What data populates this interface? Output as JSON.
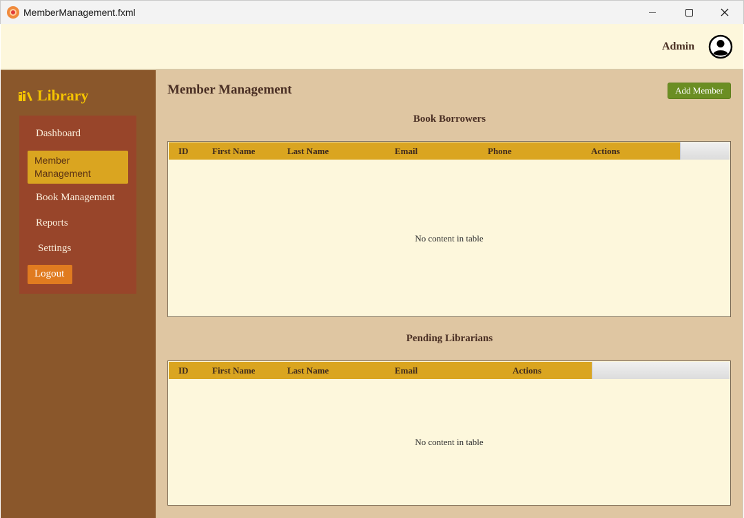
{
  "window": {
    "title": "MemberManagement.fxml"
  },
  "header": {
    "admin_label": "Admin",
    "user_icon": "account-circle-icon"
  },
  "sidebar": {
    "brand_label": "Library",
    "brand_icon": "books-icon",
    "items": [
      {
        "label": "Dashboard"
      },
      {
        "label": "Member Management"
      },
      {
        "label": "Book Management"
      },
      {
        "label": "Reports"
      },
      {
        "label": "Settings"
      }
    ],
    "logout_label": "Logout"
  },
  "main": {
    "title": "Member Management",
    "add_button_label": "Add Member",
    "borrowers": {
      "title": "Book Borrowers",
      "columns": [
        "ID",
        "First Name",
        "Last Name",
        "Email",
        "Phone",
        "Actions"
      ],
      "empty_text": "No content in table"
    },
    "librarians": {
      "title": "Pending Librarians",
      "columns": [
        "ID",
        "First Name",
        "Last Name",
        "Email",
        "Actions"
      ],
      "empty_text": "No content in table"
    }
  },
  "colors": {
    "sidebar_bg": "#8a572b",
    "nav_panel_bg": "#98452a",
    "accent": "#daa520",
    "logout": "#e07b20",
    "add_button": "#6b8e23",
    "main_bg": "#dfc6a2",
    "header_bg": "#fdf7dc"
  }
}
